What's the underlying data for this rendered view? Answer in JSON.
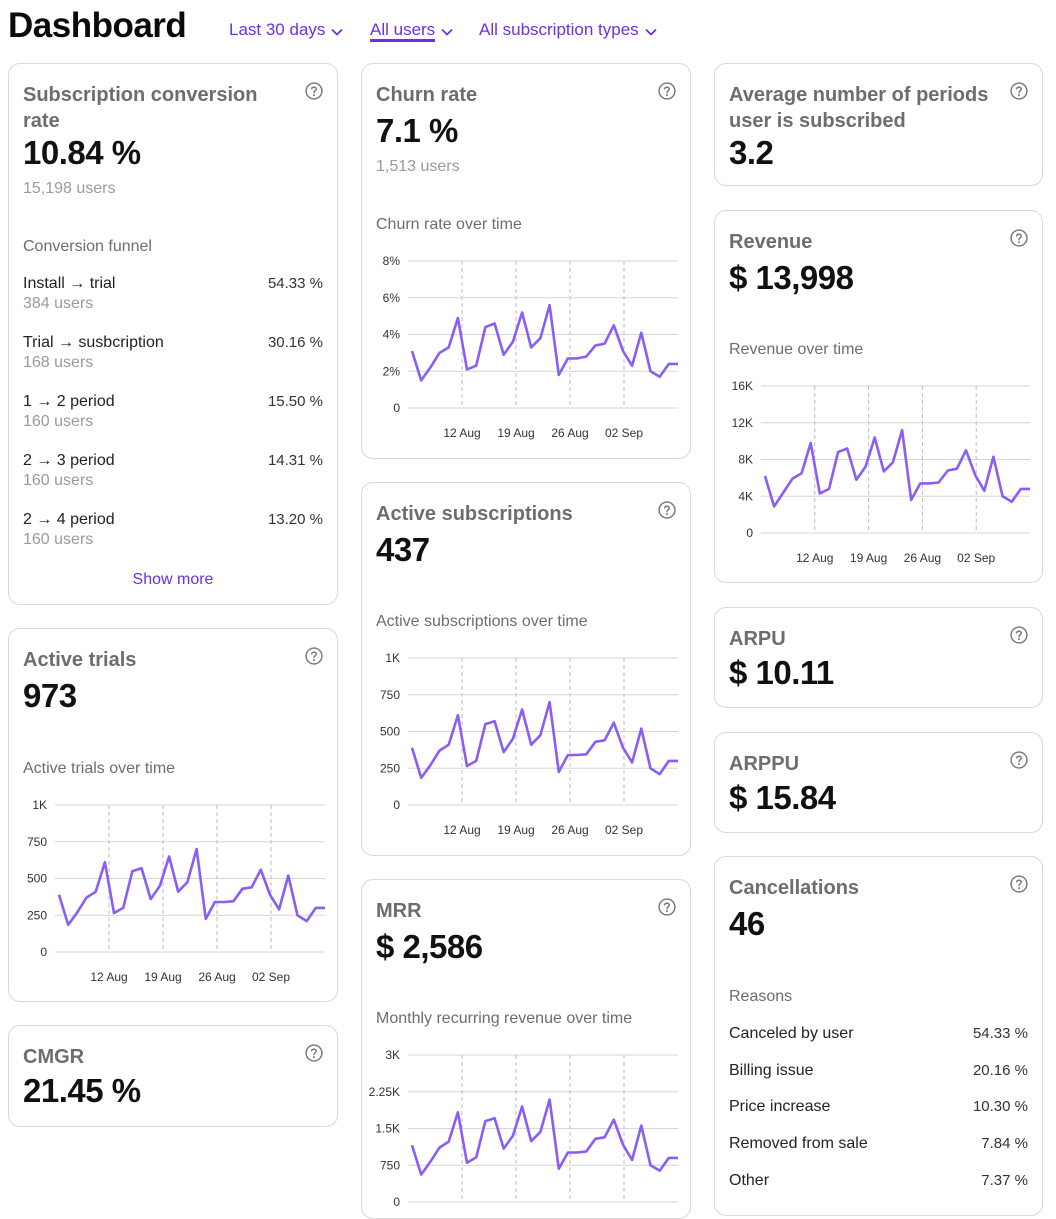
{
  "header": {
    "title": "Dashboard",
    "filters": {
      "period": "Last 30 days",
      "users": "All users",
      "subscription_types": "All subscription types"
    }
  },
  "colors": {
    "accent": "#6f2fe6",
    "line": "#8b5cf6"
  },
  "conversion": {
    "title": "Subscription conversion rate",
    "value": "10.84 %",
    "users": "15,198 users",
    "funnel_label": "Conversion funnel",
    "funnel": [
      {
        "label": "Install → trial",
        "value": "54.33 %",
        "users": "384 users"
      },
      {
        "label": "Trial → susbcription",
        "value": "30.16 %",
        "users": "168 users"
      },
      {
        "label": "1 → 2 period",
        "value": "15.50 %",
        "users": "160 users"
      },
      {
        "label": "2 → 3 period",
        "value": "14.31 %",
        "users": "160 users"
      },
      {
        "label": "2 → 4 period",
        "value": "13.20 %",
        "users": "160 users"
      }
    ],
    "show_more": "Show more"
  },
  "churn": {
    "title": "Churn rate",
    "value": "7.1 %",
    "users": "1,513 users",
    "chart_label": "Churn rate over time"
  },
  "avg_periods": {
    "title": "Average number of periods user is subscribed",
    "value": "3.2"
  },
  "revenue": {
    "title": "Revenue",
    "value": "$ 13,998",
    "chart_label": "Revenue over time"
  },
  "active_subs": {
    "title": "Active subscriptions",
    "value": "437",
    "chart_label": "Active subscriptions over time"
  },
  "arpu": {
    "title": "ARPU",
    "value": "$ 10.11"
  },
  "arppu": {
    "title": "ARPPU",
    "value": "$ 15.84"
  },
  "active_trials": {
    "title": "Active trials",
    "value": "973",
    "chart_label": "Active trials over time"
  },
  "mrr": {
    "title": "MRR",
    "value": "$ 2,586",
    "chart_label": "Monthly recurring revenue over time"
  },
  "cancellations": {
    "title": "Cancellations",
    "value": "46",
    "reasons_label": "Reasons",
    "reasons": [
      {
        "label": "Canceled by user",
        "value": "54.33 %"
      },
      {
        "label": "Billing issue",
        "value": "20.16 %"
      },
      {
        "label": "Price increase",
        "value": "10.30 %"
      },
      {
        "label": "Removed from sale",
        "value": "7.84 %"
      },
      {
        "label": "Other",
        "value": "7.37 %"
      }
    ]
  },
  "cmgr": {
    "title": "CMGR",
    "value": "21.45 %"
  },
  "chart_data": [
    {
      "id": "churn",
      "type": "line",
      "ylim": [
        0,
        8
      ],
      "yticks": [
        0,
        2,
        4,
        6,
        8
      ],
      "ytick_labels": [
        "0",
        "2%",
        "4%",
        "6%",
        "8%"
      ],
      "xtick_labels": [
        "12 Aug",
        "19 Aug",
        "26 Aug",
        "02 Sep"
      ],
      "series": [
        {
          "values": [
            3.1,
            1.5,
            2.2,
            3.0,
            3.3,
            4.9,
            2.1,
            2.3,
            4.4,
            4.6,
            2.9,
            3.6,
            5.2,
            3.3,
            3.8,
            5.6,
            1.8,
            2.7,
            2.7,
            2.8,
            3.4,
            3.5,
            4.5,
            3.1,
            2.3,
            4.1,
            2.0,
            1.7,
            2.4,
            2.4
          ]
        }
      ]
    },
    {
      "id": "revenue",
      "type": "line",
      "ylim": [
        0,
        16000
      ],
      "yticks": [
        0,
        4000,
        8000,
        12000,
        16000
      ],
      "ytick_labels": [
        "0",
        "4K",
        "8K",
        "12K",
        "16K"
      ],
      "xtick_labels": [
        "12 Aug",
        "19 Aug",
        "26 Aug",
        "02 Sep"
      ],
      "series": [
        {
          "values": [
            6200,
            2900,
            4400,
            5900,
            6500,
            9800,
            4300,
            4800,
            8800,
            9200,
            5800,
            7200,
            10400,
            6700,
            7700,
            11200,
            3600,
            5400,
            5400,
            5500,
            6800,
            7000,
            9000,
            6300,
            4600,
            8300,
            4000,
            3400,
            4800,
            4800
          ]
        }
      ]
    },
    {
      "id": "active_subs",
      "type": "line",
      "ylim": [
        0,
        1000
      ],
      "yticks": [
        0,
        250,
        500,
        750,
        1000
      ],
      "ytick_labels": [
        "0",
        "250",
        "500",
        "750",
        "1K"
      ],
      "xtick_labels": [
        "12 Aug",
        "19 Aug",
        "26 Aug",
        "02 Sep"
      ],
      "series": [
        {
          "values": [
            390,
            185,
            270,
            370,
            410,
            610,
            265,
            300,
            550,
            570,
            360,
            450,
            650,
            410,
            475,
            700,
            225,
            340,
            340,
            345,
            430,
            440,
            560,
            390,
            290,
            520,
            250,
            210,
            300,
            300
          ]
        }
      ]
    },
    {
      "id": "active_trials",
      "type": "line",
      "ylim": [
        0,
        1000
      ],
      "yticks": [
        0,
        250,
        500,
        750,
        1000
      ],
      "ytick_labels": [
        "0",
        "250",
        "500",
        "750",
        "1K"
      ],
      "xtick_labels": [
        "12 Aug",
        "19 Aug",
        "26 Aug",
        "02 Sep"
      ],
      "series": [
        {
          "values": [
            390,
            185,
            270,
            370,
            410,
            610,
            265,
            300,
            550,
            570,
            360,
            450,
            650,
            410,
            475,
            700,
            225,
            340,
            340,
            345,
            430,
            440,
            560,
            390,
            290,
            520,
            250,
            210,
            300,
            300
          ]
        }
      ]
    },
    {
      "id": "mrr",
      "type": "line",
      "ylim": [
        0,
        3000
      ],
      "yticks": [
        0,
        750,
        1500,
        2250,
        3000
      ],
      "ytick_labels": [
        "0",
        "750",
        "1.5K",
        "2.25K",
        "3K"
      ],
      "xtick_labels": [
        "12 Aug",
        "19 Aug",
        "26 Aug",
        "02 Sep"
      ],
      "series": [
        {
          "values": [
            1160,
            560,
            820,
            1110,
            1230,
            1830,
            800,
            910,
            1650,
            1710,
            1090,
            1350,
            1950,
            1240,
            1430,
            2090,
            680,
            1010,
            1010,
            1030,
            1290,
            1320,
            1680,
            1170,
            860,
            1560,
            750,
            640,
            900,
            900
          ]
        }
      ]
    }
  ]
}
